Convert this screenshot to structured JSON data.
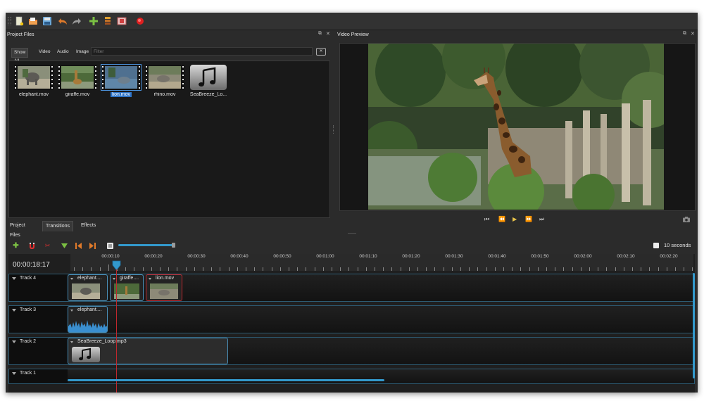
{
  "toolbar": {
    "buttons": [
      "new-project",
      "open-project",
      "save-project",
      "undo",
      "redo",
      "import-files",
      "profile",
      "export-film",
      "record"
    ]
  },
  "project_files": {
    "title": "Project Files",
    "filter_tabs": [
      "Show All",
      "Video",
      "Audio",
      "Image"
    ],
    "active_tab": "Show All",
    "filter_placeholder": "Filter",
    "files": [
      {
        "name": "elephant.mov",
        "type": "video"
      },
      {
        "name": "giraffe.mov",
        "type": "video"
      },
      {
        "name": "lion.mov",
        "type": "video",
        "selected": true
      },
      {
        "name": "rhino.mov",
        "type": "video"
      },
      {
        "name": "SeaBreeze_Lo...",
        "type": "audio"
      }
    ]
  },
  "video_preview": {
    "title": "Video Preview",
    "controls": [
      "jump-start",
      "rewind",
      "play",
      "fast-forward",
      "jump-end"
    ]
  },
  "bottom_tabs": [
    "Project Files",
    "Transitions",
    "Effects"
  ],
  "timeline": {
    "timecode": "00:00:18:17",
    "zoom_label": "10 seconds",
    "ruler_labels": [
      "00:00:10",
      "00:00:20",
      "00:00:30",
      "00:00:40",
      "00:00:50",
      "00:01:00",
      "00:01:10",
      "00:01:20",
      "00:01:30",
      "00:01:40",
      "00:01:50",
      "00:02:00",
      "00:02:10",
      "00:02:20"
    ],
    "tracks": [
      {
        "name": "Track 4",
        "clips": [
          {
            "title": "elephant....",
            "kind": "video"
          },
          {
            "title": "giraffe....",
            "kind": "video"
          },
          {
            "title": "lion.mov",
            "kind": "video"
          }
        ]
      },
      {
        "name": "Track 3",
        "clips": [
          {
            "title": "elephant....",
            "kind": "audio-wave"
          }
        ]
      },
      {
        "name": "Track 2",
        "clips": [
          {
            "title": "SeaBreeze_Loop.mp3",
            "kind": "audio"
          }
        ]
      },
      {
        "name": "Track 1",
        "clips": []
      }
    ]
  },
  "colors": {
    "accent": "#3399cc",
    "selection": "#2e74c8",
    "playhead": "#c0272d",
    "background": "#2b2b2b"
  }
}
